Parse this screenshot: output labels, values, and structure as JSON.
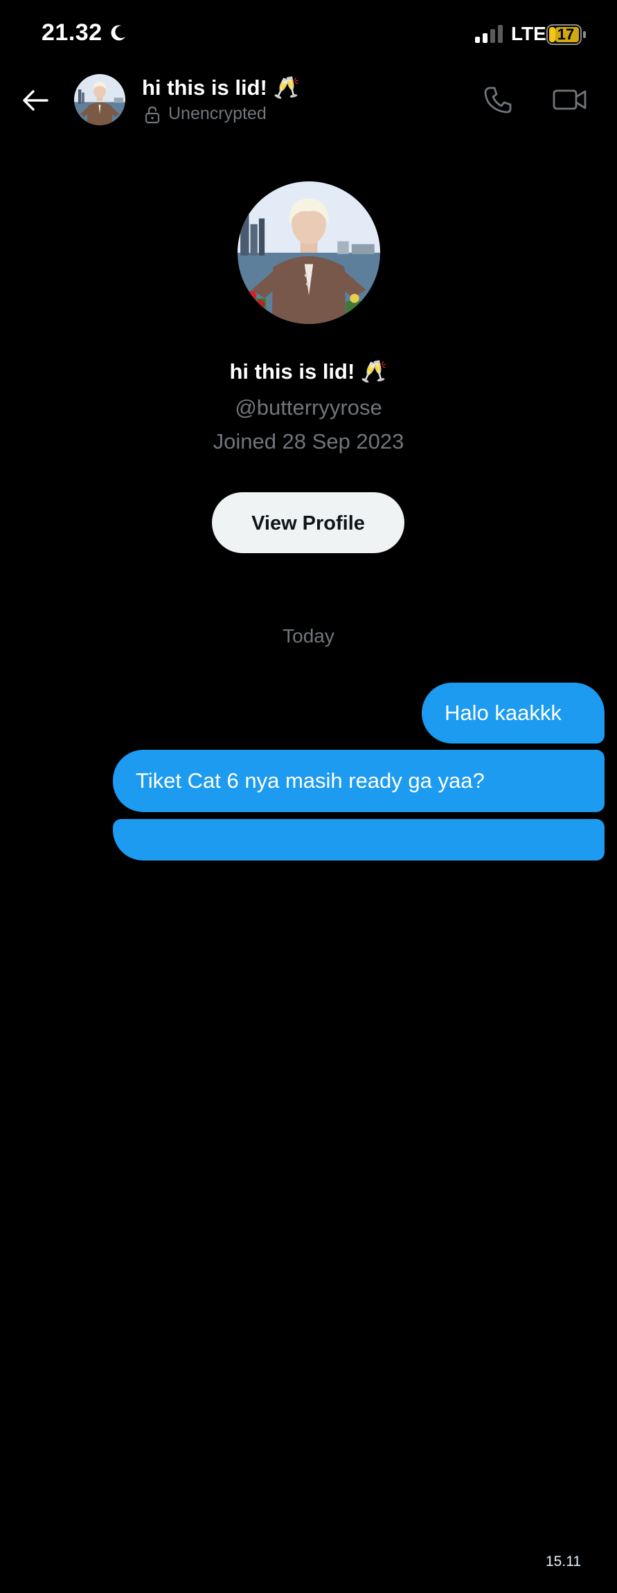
{
  "status_bar": {
    "time": "21.32",
    "network": "LTE",
    "battery": "17"
  },
  "header": {
    "title": "hi this is lid! 🥂",
    "subtitle": "Unencrypted"
  },
  "profile": {
    "name": "hi this is lid! 🥂",
    "handle": "@butterryyrose",
    "joined": "Joined 28 Sep 2023",
    "view_profile_label": "View Profile"
  },
  "conversation": {
    "day_label": "Today",
    "messages": [
      {
        "text": "Halo kaakkk"
      },
      {
        "text": "Tiket Cat 6 nya masih ready ga yaa?",
        "time": "15.11"
      }
    ]
  },
  "colors": {
    "background": "#000000",
    "bubble": "#1d9bf0",
    "muted_text": "#71767b",
    "button_bg": "#eff3f4",
    "battery_fill": "#f5c518"
  },
  "icons": [
    "moon-icon",
    "signal-icon",
    "battery-icon",
    "back-arrow-icon",
    "lock-icon",
    "phone-icon",
    "video-camera-icon"
  ]
}
